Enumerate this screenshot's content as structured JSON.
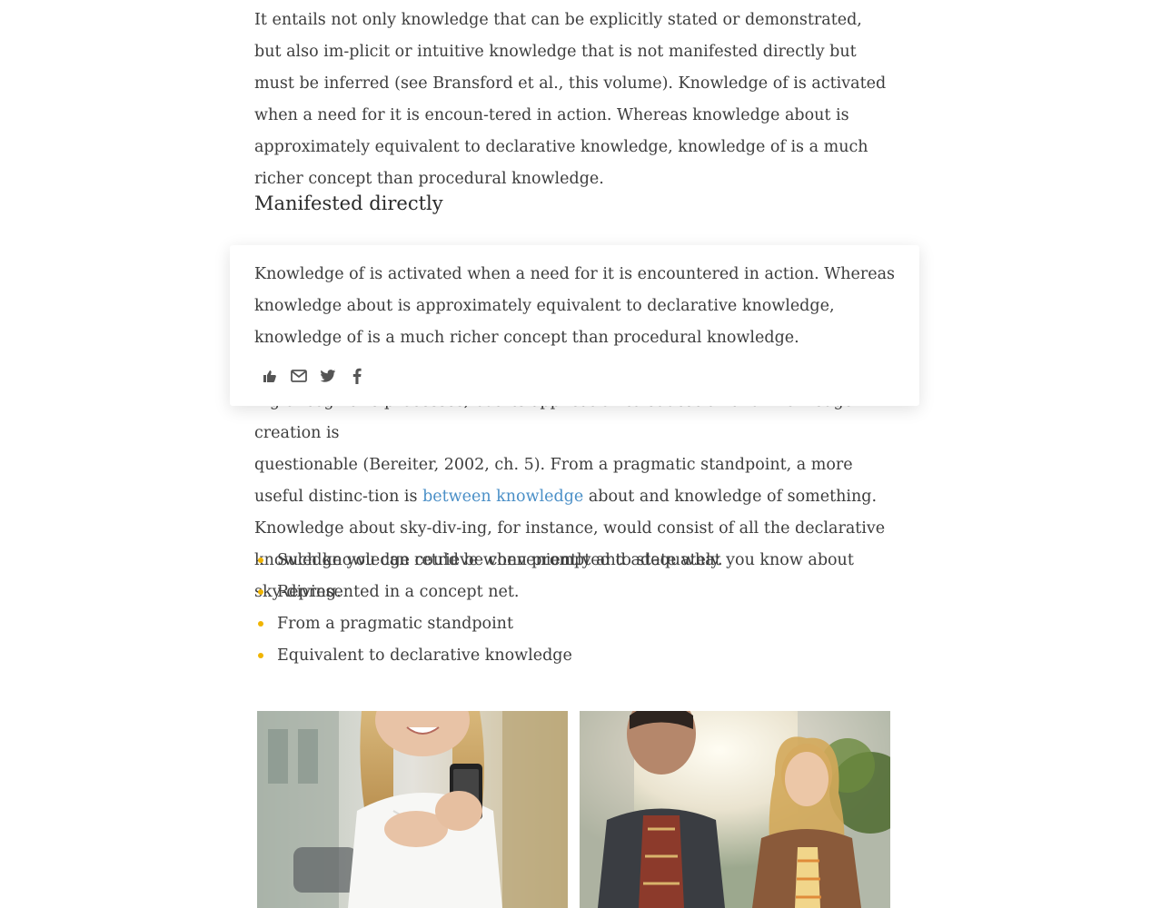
{
  "article": {
    "paragraph1": "It entails not only knowledge that can be explicitly stated or demonstrated, but also im-plicit or intuitive knowledge that is not manifested directly but must be inferred (see Bransford et al., this volume). Knowledge of is activated when a need for it is encoun-tered in action. Whereas knowledge about is approximately equivalent to declarative knowledge, knowledge of is a much richer concept than procedural knowledge.",
    "section_heading": "Manifested directly",
    "paragraph2_line1": "ing of cognitive processes, but its application to education and knowledge creation is",
    "paragraph2_before_link": "questionable (Bereiter, 2002, ch. 5). From a pragmatic standpoint, a more useful distinc-tion is ",
    "paragraph2_link": "between knowledge",
    "paragraph2_after_link": " about and knowledge of something. Knowledge about sky-div-ing, for instance, would consist of all the declarative knowledge you can retrieve when prompted to state what you know about sky-diving.",
    "bullets": [
      "Such knowledge could be conveniently and adequately.",
      "Represented in a concept net.",
      "From a pragmatic standpoint",
      "Equivalent to declarative knowledge"
    ]
  },
  "popover": {
    "quote": "Knowledge of is activated when a need for it is encountered in action. Whereas knowledge about is approximately equivalent to declarative knowledge, knowledge of is a much richer concept than procedural knowledge.",
    "share_icons": [
      "thumbs-up-icon",
      "mail-icon",
      "twitter-icon",
      "facebook-icon"
    ]
  },
  "colors": {
    "link": "#4a8fc7",
    "bullet": "#f0b400",
    "text": "#3d3d3d"
  }
}
